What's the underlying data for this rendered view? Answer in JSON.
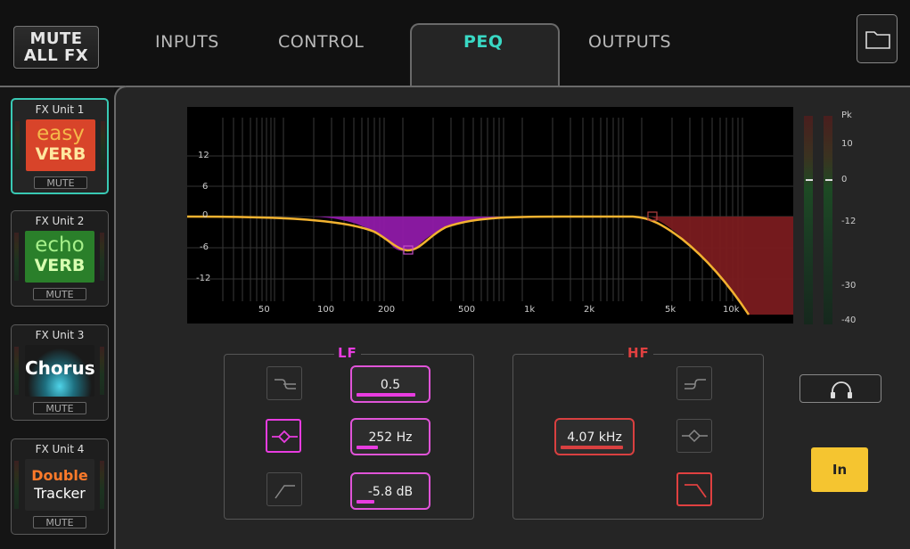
{
  "header": {
    "mute_all_line1": "MUTE",
    "mute_all_line2": "ALL FX",
    "tabs": [
      {
        "label": "INPUTS",
        "active": false
      },
      {
        "label": "CONTROL",
        "active": false
      },
      {
        "label": "PEQ",
        "active": true
      },
      {
        "label": "OUTPUTS",
        "active": false
      }
    ],
    "folder_icon": "folder-icon"
  },
  "fx_units": [
    {
      "label": "FX Unit 1",
      "art_line1": "easy",
      "art_line2": "VERB",
      "mute": "MUTE",
      "selected": true,
      "art_color": "#e04a2a"
    },
    {
      "label": "FX Unit 2",
      "art_line1": "echo",
      "art_line2": "VERB",
      "mute": "MUTE",
      "selected": false,
      "art_color": "#2e8a2e"
    },
    {
      "label": "FX Unit 3",
      "art_line1": "Chorus",
      "art_line2": "",
      "mute": "MUTE",
      "selected": false,
      "art_color": "#222222"
    },
    {
      "label": "FX Unit 4",
      "art_line1": "Double",
      "art_line2": "Tracker",
      "mute": "MUTE",
      "selected": false,
      "art_color": "#2a2a2a"
    }
  ],
  "graph": {
    "y_ticks": [
      "12",
      "6",
      "0",
      "-6",
      "-12"
    ],
    "x_ticks": [
      "50",
      "100",
      "200",
      "500",
      "1k",
      "2k",
      "5k",
      "10k"
    ],
    "lf_fill_color": "#9a1eb4",
    "hf_fill_color": "#8a1f22",
    "curve_color": "#f2b230"
  },
  "meter": {
    "scale": [
      "Pk",
      "10",
      "0",
      "-12",
      "-30",
      "-40"
    ]
  },
  "lf": {
    "title": "LF",
    "color": "#e83ce0",
    "width_value": "0.5",
    "freq_value": "252 Hz",
    "gain_value": "-5.8 dB",
    "width_level": 0.85,
    "freq_level": 0.3,
    "gain_level": 0.25,
    "selected_shape": "bell"
  },
  "hf": {
    "title": "HF",
    "color": "#e04040",
    "freq_value": "4.07 kHz",
    "freq_level": 0.88,
    "selected_shape": "low-pass"
  },
  "monitor_icon": "headphones-icon",
  "in_label": "In"
}
